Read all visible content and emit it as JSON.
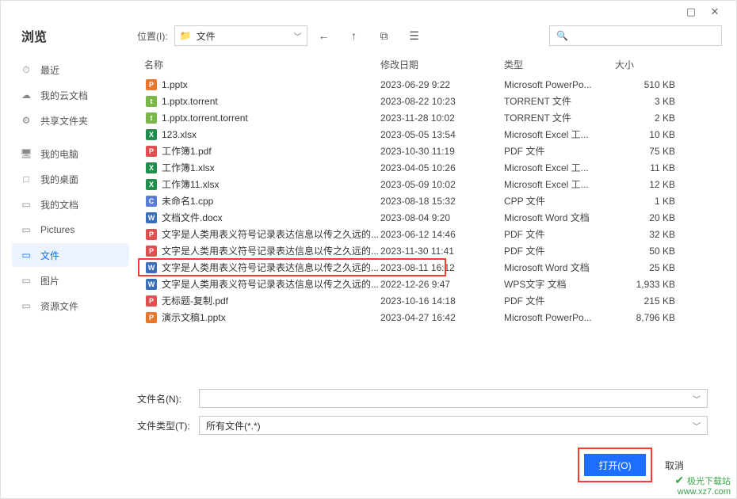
{
  "window": {
    "title": "浏览",
    "location_label": "位置(I):",
    "location_value": "文件"
  },
  "search": {
    "placeholder": ""
  },
  "sidebar": {
    "items": [
      {
        "icon": "⏱",
        "label": "最近"
      },
      {
        "icon": "☁",
        "label": "我的云文档"
      },
      {
        "icon": "⚙",
        "label": "共享文件夹"
      },
      {
        "gap": true
      },
      {
        "icon": "🖥",
        "label": "我的电脑"
      },
      {
        "icon": "□",
        "label": "我的桌面"
      },
      {
        "icon": "▭",
        "label": "我的文档"
      },
      {
        "icon": "▭",
        "label": "Pictures"
      },
      {
        "icon": "▭",
        "label": "文件",
        "active": true
      },
      {
        "icon": "▭",
        "label": "图片"
      },
      {
        "icon": "▭",
        "label": "资源文件"
      }
    ]
  },
  "columns": {
    "name": "名称",
    "date": "修改日期",
    "type": "类型",
    "size": "大小"
  },
  "files": [
    {
      "icon": "ppt",
      "g": "P",
      "name": "1.pptx",
      "date": "2023-06-29 9:22",
      "type": "Microsoft PowerPo...",
      "size": "510 KB"
    },
    {
      "icon": "torrent",
      "g": "t",
      "name": "1.pptx.torrent",
      "date": "2023-08-22 10:23",
      "type": "TORRENT 文件",
      "size": "3 KB"
    },
    {
      "icon": "torrent",
      "g": "t",
      "name": "1.pptx.torrent.torrent",
      "date": "2023-11-28 10:02",
      "type": "TORRENT 文件",
      "size": "2 KB"
    },
    {
      "icon": "xlsx",
      "g": "X",
      "name": "123.xlsx",
      "date": "2023-05-05 13:54",
      "type": "Microsoft Excel 工...",
      "size": "10 KB"
    },
    {
      "icon": "pdf",
      "g": "P",
      "name": "工作簿1.pdf",
      "date": "2023-10-30 11:19",
      "type": "PDF 文件",
      "size": "75 KB"
    },
    {
      "icon": "xlsx",
      "g": "X",
      "name": "工作簿1.xlsx",
      "date": "2023-04-05 10:26",
      "type": "Microsoft Excel 工...",
      "size": "11 KB"
    },
    {
      "icon": "xlsx",
      "g": "X",
      "name": "工作簿11.xlsx",
      "date": "2023-05-09 10:02",
      "type": "Microsoft Excel 工...",
      "size": "12 KB"
    },
    {
      "icon": "cpp",
      "g": "C",
      "name": "未命名1.cpp",
      "date": "2023-08-18 15:32",
      "type": "CPP 文件",
      "size": "1 KB"
    },
    {
      "icon": "docx",
      "g": "W",
      "name": "文档文件.docx",
      "date": "2023-08-04 9:20",
      "type": "Microsoft Word 文档",
      "size": "20 KB"
    },
    {
      "icon": "pdf",
      "g": "P",
      "name": "文字是人类用表义符号记录表达信息以传之久远的...",
      "date": "2023-06-12 14:46",
      "type": "PDF 文件",
      "size": "32 KB"
    },
    {
      "icon": "pdf",
      "g": "P",
      "name": "文字是人类用表义符号记录表达信息以传之久远的...",
      "date": "2023-11-30 11:41",
      "type": "PDF 文件",
      "size": "50 KB"
    },
    {
      "icon": "docx",
      "g": "W",
      "name": "文字是人类用表义符号记录表达信息以传之久远的...",
      "date": "2023-08-11 16:12",
      "type": "Microsoft Word 文档",
      "size": "25 KB",
      "highlighted": true
    },
    {
      "icon": "wps",
      "g": "W",
      "name": "文字是人类用表义符号记录表达信息以传之久远的...",
      "date": "2022-12-26 9:47",
      "type": "WPS文字 文档",
      "size": "1,933 KB"
    },
    {
      "icon": "pdf",
      "g": "P",
      "name": "无标题-复制.pdf",
      "date": "2023-10-16 14:18",
      "type": "PDF 文件",
      "size": "215 KB"
    },
    {
      "icon": "ppt",
      "g": "P",
      "name": "演示文稿1.pptx",
      "date": "2023-04-27 16:42",
      "type": "Microsoft PowerPo...",
      "size": "8,796 KB"
    }
  ],
  "footer": {
    "filename_label": "文件名(N):",
    "filename_value": "",
    "filetype_label": "文件类型(T):",
    "filetype_value": "所有文件(*.*)",
    "open": "打开(O)",
    "cancel": "取消"
  },
  "watermark": {
    "brand": "极光下载站",
    "url": "www.xz7.com"
  }
}
